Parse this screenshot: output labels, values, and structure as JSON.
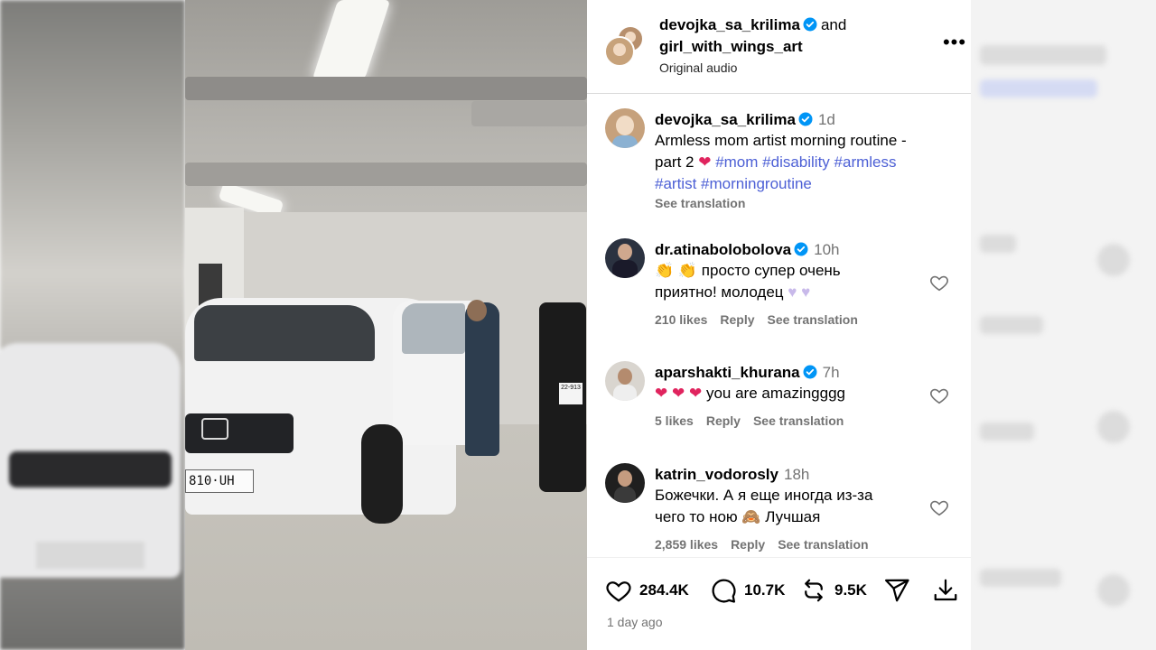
{
  "header": {
    "author_primary": "devojka_sa_krilima",
    "conjunction": "and",
    "author_secondary": "girl_with_wings_art",
    "audio": "Original audio"
  },
  "video": {
    "car_plate": "810·UH",
    "moto_plate": "22-913"
  },
  "caption": {
    "username": "devojka_sa_krilima",
    "time": "1d",
    "text": "Armless mom artist morning routine - part 2 ",
    "emoji": "❤",
    "hashtags": [
      "#mom",
      "#disability",
      "#armless",
      "#artist",
      "#morningroutine"
    ],
    "see_translation": "See translation"
  },
  "comments": [
    {
      "username": "dr.atinabolobolova",
      "verified": true,
      "time": "10h",
      "text_line1": " просто супер очень",
      "text_line2": "приятно! молодец ",
      "likes": "210 likes",
      "reply": "Reply",
      "see_translation": "See translation"
    },
    {
      "username": "aparshakti_khurana",
      "verified": true,
      "time": "7h",
      "text": " you are amazingggg",
      "likes": "5 likes",
      "reply": "Reply",
      "see_translation": "See translation"
    },
    {
      "username": "katrin_vodorosly",
      "verified": false,
      "time": "18h",
      "text_line1": "Божечки. А я еще иногда из-за",
      "text_line2": "чего то ною ",
      "text_tail": " Лучшая",
      "likes": "2,859 likes",
      "reply": "Reply",
      "see_translation": "See translation"
    }
  ],
  "actions": {
    "likes": "284.4K",
    "comments": "10.7K",
    "reposts": "9.5K"
  },
  "posted": "1 day ago",
  "colors": {
    "link": "#4c5fd5",
    "verified": "#0095f6",
    "muted": "#737373"
  }
}
